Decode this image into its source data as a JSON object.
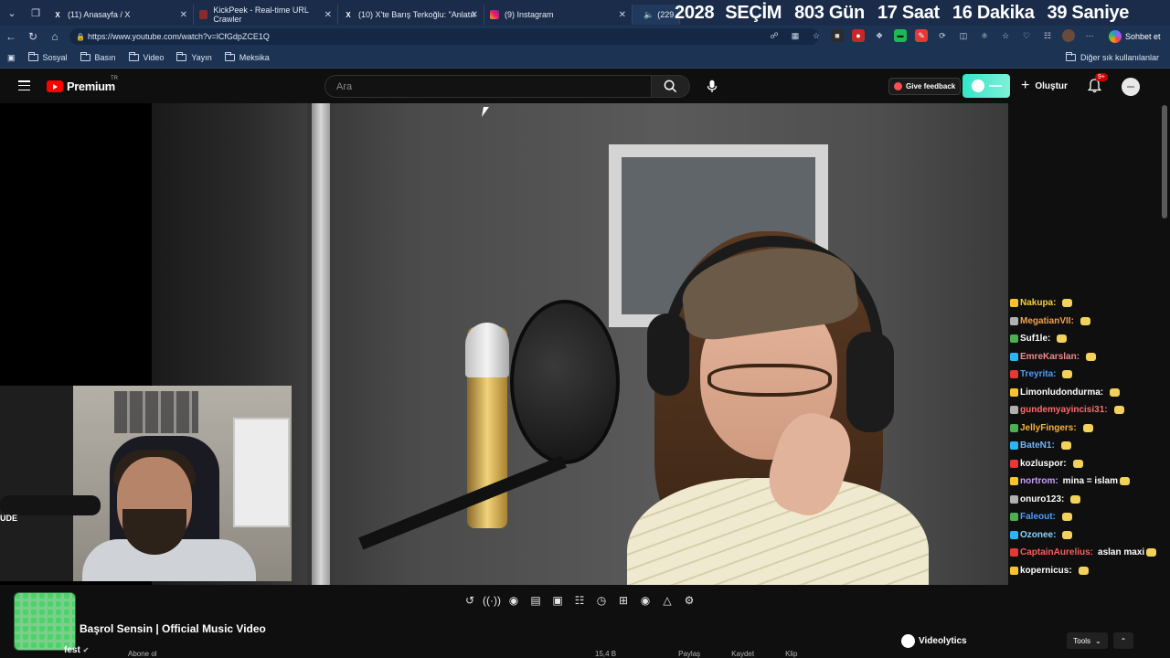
{
  "browser": {
    "tabs": [
      {
        "title": "(11) Anasayfa / X",
        "favicon": "X"
      },
      {
        "title": "KickPeek - Real-time URL Crawler",
        "favicon": "K"
      },
      {
        "title": "(10) X'te Barış Terkoğlu: \"Anlatılan",
        "favicon": "X"
      },
      {
        "title": "(9) Instagram",
        "favicon": "ig"
      },
      {
        "title": "(229",
        "favicon": "yt"
      }
    ],
    "countdown": {
      "year": "2028",
      "label": "SEÇİM",
      "days": "803 Gün",
      "hours": "17 Saat",
      "minutes": "16 Dakika",
      "seconds": "39 Saniye"
    },
    "url": "https://www.youtube.com/watch?v=lCfGdpZCE1Q",
    "copilot_label": "Sohbet et",
    "bookmarks": [
      "Sosyal",
      "Basın",
      "Video",
      "Yayın",
      "Meksika"
    ],
    "other_bookmarks": "Diğer sık kullanılanlar"
  },
  "youtube": {
    "brand": "Premium",
    "region": "TR",
    "search_placeholder": "Ara",
    "feedback_label": "Give feedback",
    "create_label": "Oluştur",
    "notification_badge": "9+",
    "video_title": "Başrol Sensin | Official Music Video",
    "channel_name": "fest",
    "subscribe_label": "Abone ol",
    "actions": [
      "15,4 B",
      "",
      "Paylaş",
      "Kaydet",
      "Klip"
    ],
    "videolytics_label": "Videolytics",
    "tools_label": "Tools"
  },
  "facecam": {
    "overlay_text": "UDE"
  },
  "chat": [
    {
      "user": "Nakupa:",
      "color": "#f4d03f",
      "text": ""
    },
    {
      "user": "MegatianVII:",
      "color": "#f4a14b",
      "text": ""
    },
    {
      "user": "Suf1le:",
      "color": "#ffffff",
      "text": ""
    },
    {
      "user": "EmreKarslan:",
      "color": "#f08b8b",
      "text": ""
    },
    {
      "user": "Treyrita:",
      "color": "#4d9cff",
      "text": ""
    },
    {
      "user": "Limonludondurma:",
      "color": "#ffffff",
      "text": ""
    },
    {
      "user": "gundemyayincisi31:",
      "color": "#ff6b6b",
      "text": ""
    },
    {
      "user": "JellyFingers:",
      "color": "#f6b23e",
      "text": ""
    },
    {
      "user": "BateN1:",
      "color": "#6fb6ff",
      "text": ""
    },
    {
      "user": "kozluspor:",
      "color": "#ffffff",
      "text": ""
    },
    {
      "user": "nortrom:",
      "color": "#c8a0ff",
      "text": "mina = islam"
    },
    {
      "user": "onuro123:",
      "color": "#ffffff",
      "text": ""
    },
    {
      "user": "Faleout:",
      "color": "#4d9cff",
      "text": ""
    },
    {
      "user": "Ozonee:",
      "color": "#8ed3ff",
      "text": ""
    },
    {
      "user": "CaptainAurelius:",
      "color": "#ff5c5c",
      "text": "aslan maxi"
    },
    {
      "user": "kopernicus:",
      "color": "#ffffff",
      "text": ""
    }
  ],
  "icons": {
    "tools": [
      "repeat-icon",
      "broadcast-icon",
      "eye-icon",
      "clapper-icon",
      "pip-icon",
      "film-icon",
      "speed-icon",
      "add-icon",
      "camera-icon",
      "flask-icon",
      "gear-icon"
    ]
  }
}
